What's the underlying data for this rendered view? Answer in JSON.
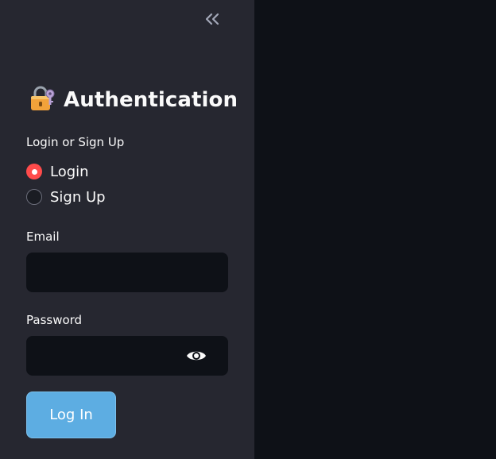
{
  "sidebar": {
    "collapse_icon": "double-chevron-left-icon",
    "title_icon": "locked-with-key-icon",
    "title": "Authentication",
    "mode": {
      "label": "Login or Sign Up",
      "options": [
        {
          "label": "Login",
          "selected": true
        },
        {
          "label": "Sign Up",
          "selected": false
        }
      ]
    },
    "email": {
      "label": "Email",
      "value": ""
    },
    "password": {
      "label": "Password",
      "value": "",
      "toggle_icon": "eye-icon"
    },
    "submit_label": "Log In"
  },
  "colors": {
    "sidebar_bg": "#262730",
    "main_bg": "#0e1117",
    "accent": "#ff4b4b",
    "button": "#5dade2"
  }
}
